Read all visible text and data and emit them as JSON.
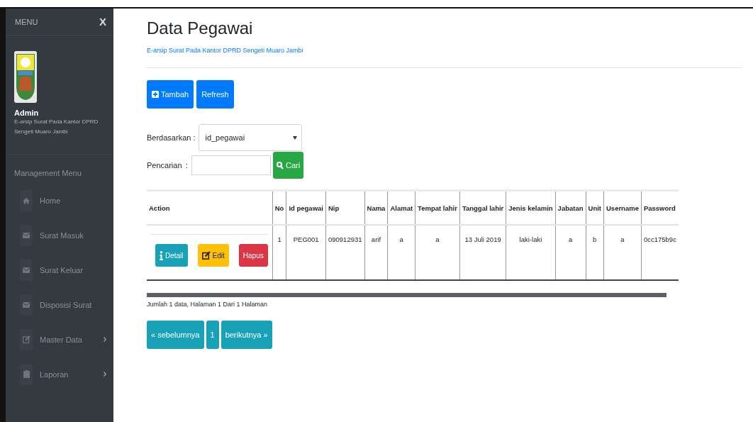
{
  "sidebar": {
    "title": "MENU",
    "close": "X",
    "user": {
      "name": "Admin",
      "subtitle": "E-arsip Surat Pada Kantor DPRD Sengeti Muaro Jambi"
    },
    "section": "Management Menu",
    "items": [
      {
        "label": "Home",
        "submenu": false
      },
      {
        "label": "Surat Masuk",
        "submenu": false
      },
      {
        "label": "Surat Keluar",
        "submenu": false
      },
      {
        "label": "Disposisi Surat",
        "submenu": false
      },
      {
        "label": "Master Data",
        "submenu": true
      },
      {
        "label": "Laporan",
        "submenu": true
      }
    ]
  },
  "page": {
    "title": "Data Pegawai",
    "subtitle": "E-arsip Surat Pada Kantor DPRD Sengeti Muaro Jambi"
  },
  "toolbar": [
    {
      "kind": "add",
      "label": "Tambah"
    },
    {
      "kind": "refresh",
      "label": "Refresh"
    }
  ],
  "filter": {
    "label": "Berdasarkan",
    "separator": ":",
    "value": "id_pegawai"
  },
  "search": {
    "label": "Pencarian",
    "separator": ":",
    "button": "Cari"
  },
  "table": {
    "columns": [
      "Action",
      "No",
      "Id pegawai",
      "Nip",
      "Nama",
      "Alamat",
      "Tempat lahir",
      "Tanggal lahir",
      "Jenis kelamin",
      "Jabatan",
      "Unit",
      "Username",
      "Password"
    ],
    "rows": [
      {
        "cells": [
          {
            "buttons": [
              {
                "kind": "info",
                "label": "Detail"
              },
              {
                "kind": "warning",
                "label": "Edit"
              },
              {
                "kind": "danger",
                "label": "Hapus"
              }
            ]
          },
          "1",
          "PEG001",
          "090912931",
          "arif",
          "a",
          "a",
          "13 Juli 2019",
          "laki-laki",
          "a",
          "b",
          "a",
          "0cc175b9c"
        ]
      }
    ]
  },
  "summary": "Jumlah 1 data, Halaman 1 Dari 1 Halaman",
  "pagination": [
    "« sebelumnya",
    "1",
    "berikutnya »"
  ]
}
